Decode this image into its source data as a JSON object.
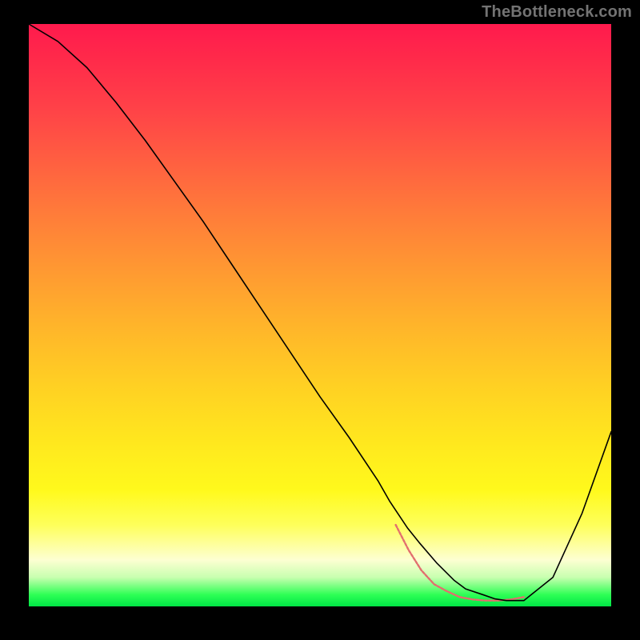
{
  "watermark": "TheBottleneck.com",
  "chart_data": {
    "type": "line",
    "title": "",
    "xlabel": "",
    "ylabel": "",
    "xlim": [
      0,
      100
    ],
    "ylim": [
      0,
      100
    ],
    "grid": false,
    "legend": false,
    "series": [
      {
        "name": "bottleneck-curve",
        "color": "#000000",
        "x": [
          0,
          5,
          10,
          15,
          20,
          25,
          30,
          35,
          40,
          45,
          50,
          55,
          60,
          62,
          65,
          67,
          70,
          73,
          75,
          78,
          80,
          82,
          85,
          90,
          95,
          100
        ],
        "y": [
          100,
          97,
          92.5,
          86.5,
          80,
          73,
          66,
          58.5,
          51,
          43.5,
          36,
          29,
          21.5,
          18,
          13.5,
          11,
          7.5,
          4.5,
          3,
          2,
          1.3,
          1,
          1,
          5,
          16,
          30
        ]
      }
    ],
    "highlight": {
      "name": "minimum-region",
      "color": "#e26e6e",
      "x_range": [
        63,
        85
      ],
      "y": [
        14,
        9.7,
        6.2,
        3.8,
        2.6,
        1.6,
        1.2,
        1.0,
        1.0,
        1.2,
        1.6
      ]
    }
  }
}
